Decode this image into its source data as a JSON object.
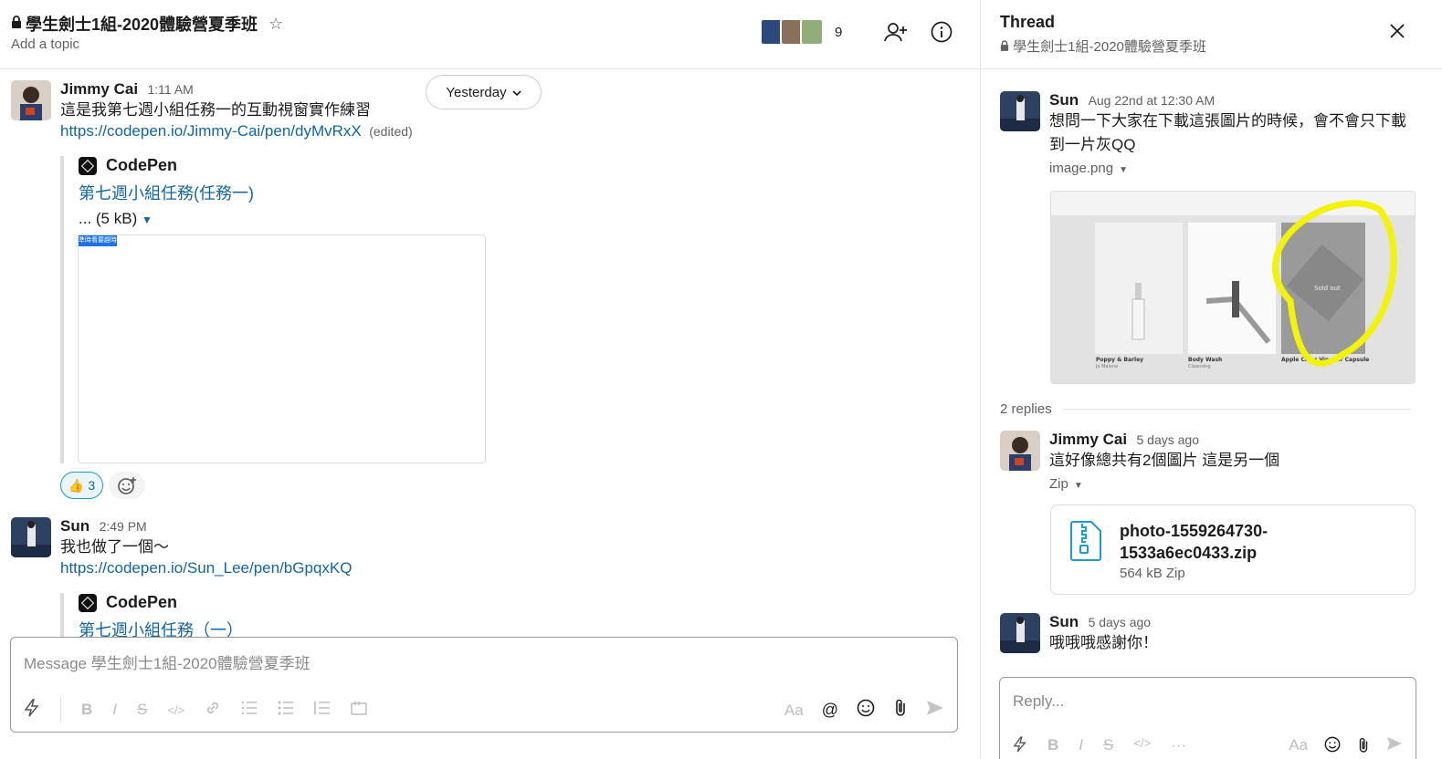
{
  "channel": {
    "name": "學生劍士1組-2020體驗營夏季班",
    "topic_placeholder": "Add a topic",
    "member_count": "9"
  },
  "day_divider": "Yesterday",
  "messages": [
    {
      "author": "Jimmy Cai",
      "time": "1:11 AM",
      "text": "這是我第七週小組任務一的互動視窗實作練習",
      "link": "https://codepen.io/Jimmy-Cai/pen/dyMvRxX",
      "edited": "(edited)",
      "unfurl": {
        "source": "CodePen",
        "title": "第七週小組任務(任務一)",
        "size": "... (5 kB)",
        "preview_tag": "準時看要趕時"
      },
      "reaction": {
        "emoji": "👍",
        "count": "3"
      }
    },
    {
      "author": "Sun",
      "time": "2:49 PM",
      "text": "我也做了一個～",
      "link": "https://codepen.io/Sun_Lee/pen/bGpqxKQ",
      "unfurl": {
        "source": "CodePen",
        "title": "第七週小組任務（一）"
      }
    }
  ],
  "composer": {
    "placeholder": "Message 學生劍士1組-2020體驗營夏季班",
    "format_aa": "Aa"
  },
  "thread": {
    "title": "Thread",
    "channel": "學生劍士1組-2020體驗營夏季班",
    "root": {
      "author": "Sun",
      "time": "Aug 22nd at 12:30 AM",
      "text": "想問一下大家在下載這張圖片的時候，會不會只下載到一片灰QQ",
      "file_label": "image.png",
      "image_products": [
        {
          "name": "Poppy & Barley",
          "sub": "Jo Malone"
        },
        {
          "name": "Body Wash",
          "sub": "Cleansing"
        },
        {
          "name": "Apple Cider Vinegar Capsule",
          "sub": ""
        }
      ],
      "image_sold_out": "Sold out"
    },
    "replies_label": "2 replies",
    "replies": [
      {
        "author": "Jimmy Cai",
        "time": "5 days ago",
        "text": "這好像總共有2個圖片 這是另一個",
        "file_label": "Zip",
        "file_name": "photo-1559264730-1533a6ec0433.zip",
        "file_meta": "564 kB Zip"
      },
      {
        "author": "Sun",
        "time": "5 days ago",
        "text": "哦哦哦感謝你！"
      }
    ],
    "reply_placeholder": "Reply...",
    "format_aa": "Aa"
  },
  "colors": {
    "link": "#1264a3",
    "highlight_circle": "#f2f20a"
  }
}
